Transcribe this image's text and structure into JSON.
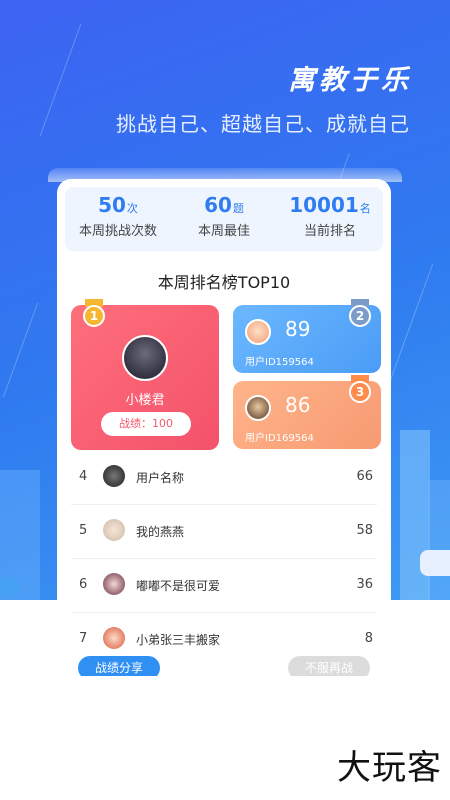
{
  "hero": {
    "title": "寓教于乐",
    "subtitle": "挑战自己、超越自己、成就自己"
  },
  "stats": [
    {
      "value": "50",
      "unit": "次",
      "label": "本周挑战次数"
    },
    {
      "value": "60",
      "unit": "题",
      "label": "本周最佳"
    },
    {
      "value": "10001",
      "unit": "名",
      "label": "当前排名"
    }
  ],
  "board": {
    "title": "本周排名榜TOP10",
    "first": {
      "rank": "1",
      "name": "小楼君",
      "score_text": "战绩：100"
    },
    "second": {
      "rank": "2",
      "score": "89",
      "user_id": "用户ID159564"
    },
    "third": {
      "rank": "3",
      "score": "86",
      "user_id": "用户ID169564"
    }
  },
  "rank_list": [
    {
      "rank": "4",
      "name": "用户名称",
      "score": "66"
    },
    {
      "rank": "5",
      "name": "我的燕燕",
      "score": "58"
    },
    {
      "rank": "6",
      "name": "嘟嘟不是很可爱",
      "score": "36"
    },
    {
      "rank": "7",
      "name": "小弟张三丰搬家",
      "score": "8"
    }
  ],
  "buttons": {
    "share": "战绩分享",
    "again": "不服再战"
  },
  "brand": "大玩客",
  "colors": {
    "primary": "#2f7df0",
    "first_card": "#f3526a",
    "second_card": "#4a9cf6",
    "third_card": "#f79a72",
    "medal_gold": "#f5b731",
    "medal_silver": "#7b9cc8",
    "medal_bronze": "#ff8c4a"
  }
}
